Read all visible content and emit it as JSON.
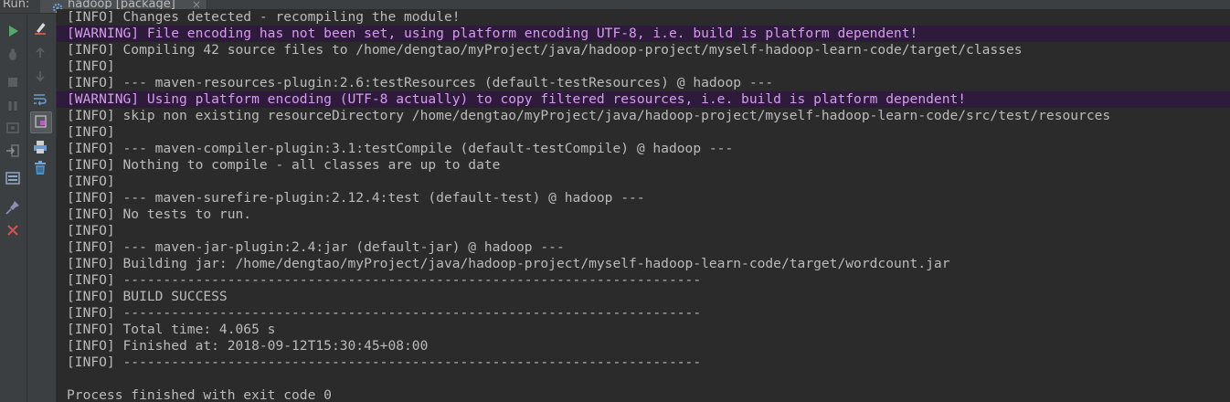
{
  "run_panel": {
    "label": "Run:",
    "tab": {
      "label": "hadoop [package]",
      "close": "×"
    }
  },
  "toolbar": {
    "left_column": [
      {
        "name": "rerun-icon",
        "interactable": true
      },
      {
        "name": "debug-icon",
        "interactable": true
      },
      {
        "name": "stop-icon",
        "interactable": true
      },
      {
        "name": "pause-icon",
        "interactable": true
      },
      {
        "name": "dump-threads-icon",
        "interactable": true
      },
      {
        "name": "exit-icon",
        "interactable": true
      },
      {
        "name": "layout-icon",
        "interactable": true
      },
      {
        "name": "pin-icon",
        "interactable": true
      },
      {
        "name": "close-icon",
        "interactable": true
      }
    ],
    "right_column": [
      {
        "name": "edit-config-icon",
        "interactable": true
      },
      {
        "name": "up-arrow-icon",
        "interactable": true
      },
      {
        "name": "down-arrow-icon",
        "interactable": true
      },
      {
        "name": "soft-wrap-icon",
        "interactable": true
      },
      {
        "name": "scroll-to-end-icon",
        "interactable": true
      },
      {
        "name": "print-icon",
        "interactable": true
      },
      {
        "name": "clear-all-icon",
        "interactable": true
      }
    ]
  },
  "colors": {
    "background": "#2b2b2b",
    "panel": "#3c3f41",
    "text": "#bbbbbb",
    "warning_bg": "#2e1b3b",
    "warning_text": "#d59ced",
    "rerun_green": "#59a869",
    "close_red": "#c75450"
  },
  "console": {
    "lines": [
      {
        "type": "info",
        "text": "[INFO] Changes detected - recompiling the module!"
      },
      {
        "type": "warning",
        "text": "[WARNING] File encoding has not been set, using platform encoding UTF-8, i.e. build is platform dependent!"
      },
      {
        "type": "info",
        "text": "[INFO] Compiling 42 source files to /home/dengtao/myProject/java/hadoop-project/myself-hadoop-learn-code/target/classes"
      },
      {
        "type": "info",
        "text": "[INFO]"
      },
      {
        "type": "info",
        "text": "[INFO] --- maven-resources-plugin:2.6:testResources (default-testResources) @ hadoop ---"
      },
      {
        "type": "warning",
        "text": "[WARNING] Using platform encoding (UTF-8 actually) to copy filtered resources, i.e. build is platform dependent!"
      },
      {
        "type": "info",
        "text": "[INFO] skip non existing resourceDirectory /home/dengtao/myProject/java/hadoop-project/myself-hadoop-learn-code/src/test/resources"
      },
      {
        "type": "info",
        "text": "[INFO]"
      },
      {
        "type": "info",
        "text": "[INFO] --- maven-compiler-plugin:3.1:testCompile (default-testCompile) @ hadoop ---"
      },
      {
        "type": "info",
        "text": "[INFO] Nothing to compile - all classes are up to date"
      },
      {
        "type": "info",
        "text": "[INFO]"
      },
      {
        "type": "info",
        "text": "[INFO] --- maven-surefire-plugin:2.12.4:test (default-test) @ hadoop ---"
      },
      {
        "type": "info",
        "text": "[INFO] No tests to run."
      },
      {
        "type": "info",
        "text": "[INFO]"
      },
      {
        "type": "info",
        "text": "[INFO] --- maven-jar-plugin:2.4:jar (default-jar) @ hadoop ---"
      },
      {
        "type": "info",
        "text": "[INFO] Building jar: /home/dengtao/myProject/java/hadoop-project/myself-hadoop-learn-code/target/wordcount.jar"
      },
      {
        "type": "info",
        "text": "[INFO] ------------------------------------------------------------------------"
      },
      {
        "type": "info",
        "text": "[INFO] BUILD SUCCESS"
      },
      {
        "type": "info",
        "text": "[INFO] ------------------------------------------------------------------------"
      },
      {
        "type": "info",
        "text": "[INFO] Total time: 4.065 s"
      },
      {
        "type": "info",
        "text": "[INFO] Finished at: 2018-09-12T15:30:45+08:00"
      },
      {
        "type": "info",
        "text": "[INFO] ------------------------------------------------------------------------"
      },
      {
        "type": "blank",
        "text": ""
      },
      {
        "type": "process",
        "text": "Process finished with exit code 0"
      }
    ]
  }
}
